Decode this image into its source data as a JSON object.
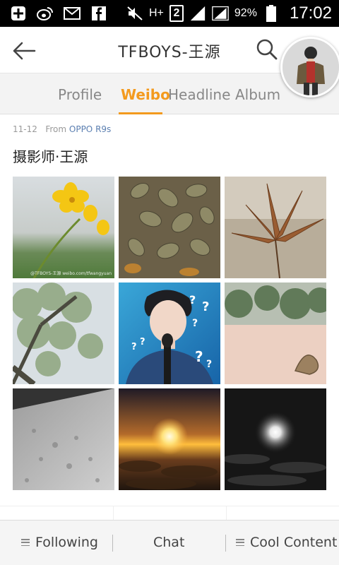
{
  "status_bar": {
    "battery_percent": "92%",
    "time": "17:02",
    "network_badge": "2",
    "network_type": "H+"
  },
  "header": {
    "title": "TFBOYS-王源"
  },
  "tabs": [
    {
      "label": "Profile"
    },
    {
      "label": "Weibo",
      "active": true
    },
    {
      "label": "Headline"
    },
    {
      "label": "Album"
    }
  ],
  "post": {
    "date": "11-12",
    "from_label": "From",
    "source": "OPPO R9s",
    "text": "摄影师·王源",
    "photo_watermark": "@TFBOYS-王源 weibo.com/tfwangyuan",
    "photos": [
      {
        "subject": "yellow flower"
      },
      {
        "subject": "leaves"
      },
      {
        "subject": "maple leaf"
      },
      {
        "subject": "trees"
      },
      {
        "subject": "portrait"
      },
      {
        "subject": "leaf on sand"
      },
      {
        "subject": "sand texture"
      },
      {
        "subject": "sunset clouds"
      },
      {
        "subject": "night sun"
      }
    ]
  },
  "bottom_bar": {
    "following": "Following",
    "chat": "Chat",
    "cool_content": "Cool Content"
  },
  "colors": {
    "accent": "#f39a1e",
    "link": "#5b7fb1"
  }
}
